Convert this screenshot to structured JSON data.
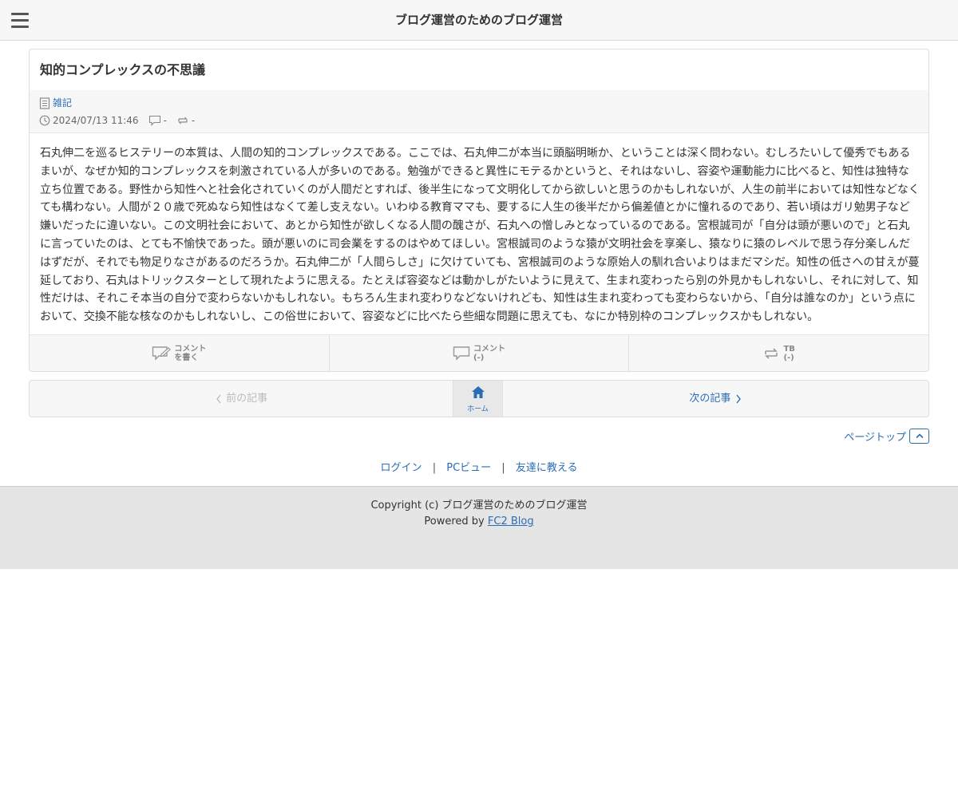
{
  "header": {
    "site_title": "ブログ運営のためのブログ運営"
  },
  "article": {
    "title": "知的コンプレックスの不思議",
    "category": "雑記",
    "datetime": "2024/07/13 11:46",
    "comment_count": "-",
    "trackback_count": "-",
    "body": "石丸伸二を巡るヒステリーの本質は、人間の知的コンプレックスである。ここでは、石丸伸二が本当に頭脳明晰か、ということは深く問わない。むしろたいして優秀でもあるまいが、なぜか知的コンプレックスを刺激されている人が多いのである。勉強ができると異性にモテるかというと、それはないし、容姿や運動能力に比べると、知性は独特な立ち位置である。野性から知性へと社会化されていくのが人間だとすれば、後半生になって文明化してから欲しいと思うのかもしれないが、人生の前半においては知性などなくても構わない。人間が２０歳で死ぬなら知性はなくて差し支えない。いわゆる教育ママも、要するに人生の後半だから偏差値とかに憧れるのであり、若い頃はガリ勉男子など嫌いだったに違いない。この文明社会において、あとから知性が欲しくなる人間の醜さが、石丸への憎しみとなっているのである。宮根誠司が「自分は頭が悪いので」と石丸に言っていたのは、とても不愉快であった。頭が悪いのに司会業をするのはやめてほしい。宮根誠司のような猿が文明社会を享楽し、猿なりに猿のレベルで思う存分楽しんだはずだが、それでも物足りなさがあるのだろうか。石丸伸二が「人間らしさ」に欠けていても、宮根誠司のような原始人の馴れ合いよりはまだマシだ。知性の低さへの甘えが蔓延しており、石丸はトリックスターとして現れたように思える。たとえば容姿などは動かしがたいように見えて、生まれ変わったら別の外見かもしれないし、それに対して、知性だけは、それこそ本当の自分で変わらないかもしれない。もちろん生まれ変わりなどないけれども、知性は生まれ変わっても変わらないから、「自分は誰なのか」という点において、交換不能な核なのかもしれないし、この俗世において、容姿などに比べたら些細な問題に思えても、なにか特別枠のコンプレックスかもしれない。"
  },
  "actions": {
    "write_comment_line1": "コメント",
    "write_comment_line2": "を書く",
    "comments_line1": "コメント",
    "comments_line2": "(-)",
    "tb_line1": "TB",
    "tb_line2": "(-)"
  },
  "pager": {
    "prev_label": "前の記事",
    "home_label": "ホーム",
    "next_label": "次の記事"
  },
  "pagetop": {
    "label": "ページトップ"
  },
  "footer_links": {
    "login": "ログイン",
    "pc_view": "PCビュー",
    "tell_friend": "友達に教える",
    "separator": "|"
  },
  "footer": {
    "copyright": "Copyright (c) ブログ運営のためのブログ運営",
    "powered_prefix": "Powered by ",
    "powered_link": "FC2 Blog"
  },
  "colors": {
    "link": "#2a6db5",
    "header_bg": "#f7f7f7",
    "footer_bg": "#e5e5e5"
  }
}
